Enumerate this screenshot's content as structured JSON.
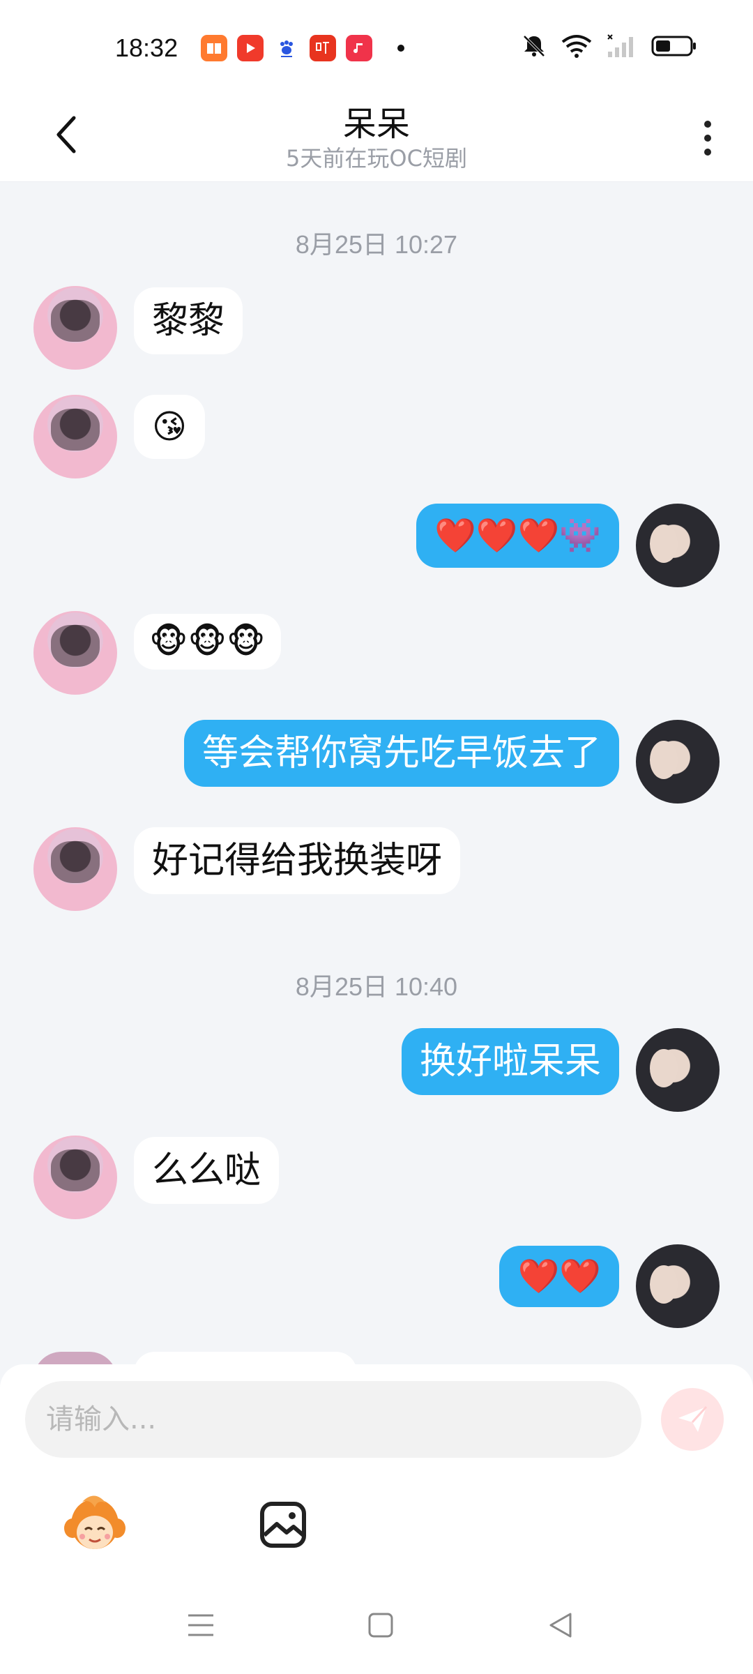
{
  "status_bar": {
    "time": "18:32",
    "apps": [
      {
        "icon": "book-app-icon",
        "color": "#ff7a2f",
        "glyph": "▤"
      },
      {
        "icon": "video-play-app-icon",
        "color": "#f03a2b",
        "glyph": "▶"
      },
      {
        "icon": "baidu-paw-app-icon",
        "color": "#ffffff",
        "glyph": "🐾"
      },
      {
        "icon": "ting-audio-app-icon",
        "color": "#e8341f",
        "glyph": "听"
      },
      {
        "icon": "music-note-app-icon",
        "color": "#f0334a",
        "glyph": "♪"
      }
    ],
    "icons": [
      "mute-bell-icon",
      "wifi-icon",
      "signal-icon",
      "battery-icon"
    ]
  },
  "header": {
    "title": "呆呆",
    "subtitle": "5天前在玩OC短剧"
  },
  "messages": [
    {
      "type": "timestamp",
      "text": "8月25日 10:27"
    },
    {
      "type": "in",
      "text": "黎黎"
    },
    {
      "type": "in",
      "text": "😘"
    },
    {
      "type": "out",
      "text": "❤️❤️❤️👾"
    },
    {
      "type": "in",
      "text": "🐵🐵🐵"
    },
    {
      "type": "out",
      "text": "等会帮你窝先吃早饭去了"
    },
    {
      "type": "in",
      "text": "好记得给我换装呀"
    },
    {
      "type": "timestamp",
      "text": "8月25日 10:40"
    },
    {
      "type": "out",
      "text": "换好啦呆呆"
    },
    {
      "type": "in",
      "text": "么么哒"
    },
    {
      "type": "out",
      "text": "❤️❤️"
    }
  ],
  "composer": {
    "placeholder": "请输入...",
    "tools": [
      "monkey-emoji-icon",
      "image-icon"
    ]
  },
  "nav_bar": [
    "menu-nav-icon",
    "home-nav-icon",
    "back-nav-icon"
  ]
}
